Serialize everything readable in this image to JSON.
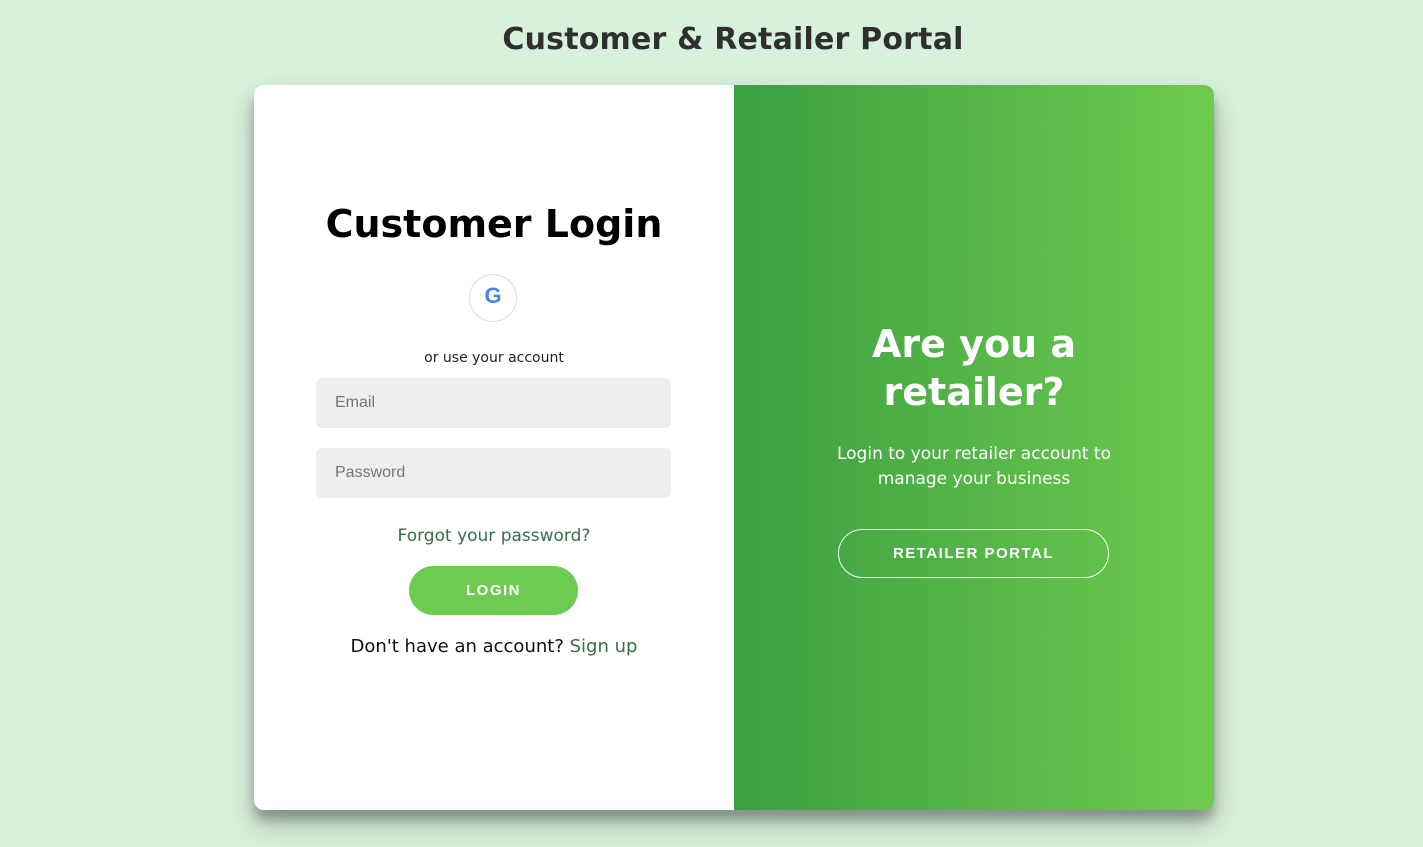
{
  "page": {
    "title": "Customer & Retailer Portal"
  },
  "customer_login": {
    "heading": "Customer Login",
    "social": {
      "icon": "google-icon",
      "glyph": "G"
    },
    "alt_text": "or use your account",
    "email": {
      "placeholder": "Email",
      "value": ""
    },
    "password": {
      "placeholder": "Password",
      "value": ""
    },
    "forgot_password": "Forgot your password?",
    "login_button": "LOGIN",
    "signup_prompt": "Don't have an account?",
    "signup_link": "Sign up"
  },
  "retailer_panel": {
    "heading_line1": "Are you a",
    "heading_line2": "retailer?",
    "text": "Login to your retailer account to manage your business",
    "button": "RETAILER PORTAL"
  },
  "colors": {
    "background": "#d8f1dc",
    "accent_green": "#6ecb51",
    "gradient_start": "#3a9f40",
    "gradient_end": "#6fcb4f",
    "link_green": "#3b6b4b",
    "google_blue": "#4285f4"
  }
}
